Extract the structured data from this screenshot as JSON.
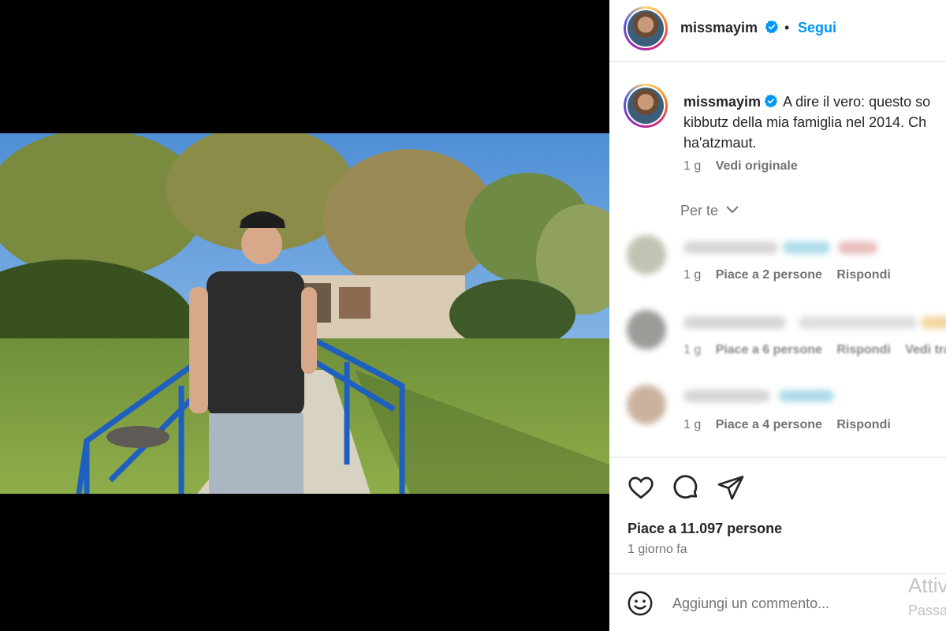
{
  "post": {
    "username": "missmayim",
    "follow_label": "Segui",
    "separator": "•",
    "caption": {
      "username": "missmayim",
      "text": "A dire il vero: questo so kibbutz della mia famiglia nel 2014. Ch ha'atzmaut.",
      "time": "1 g",
      "translate_label": "Vedi originale"
    },
    "for_you_label": "Per te",
    "comments": [
      {
        "time": "1 g",
        "likes": "Piace a 2 persone",
        "reply": "Rispondi"
      },
      {
        "time": "1 g",
        "likes": "Piace a 6 persone",
        "reply": "Rispondi",
        "extra": "Vedi tra"
      },
      {
        "time": "1 g",
        "likes": "Piace a 4 persone",
        "reply": "Rispondi"
      }
    ],
    "likes_text": "Piace a 11.097 persone",
    "posted_time": "1 giorno fa",
    "comment_placeholder": "Aggiungi un commento...",
    "overlay": {
      "activate": "Attiv",
      "sub": "Passa"
    }
  },
  "icons": {
    "verified": "verified-badge-icon",
    "like": "heart-icon",
    "comment": "comment-bubble-icon",
    "share": "paper-plane-icon",
    "emoji": "emoji-icon",
    "chevron": "chevron-down-icon"
  },
  "colors": {
    "link_blue": "#0095f6",
    "text": "#262626",
    "secondary": "#737373",
    "border": "#dbdbdb"
  }
}
